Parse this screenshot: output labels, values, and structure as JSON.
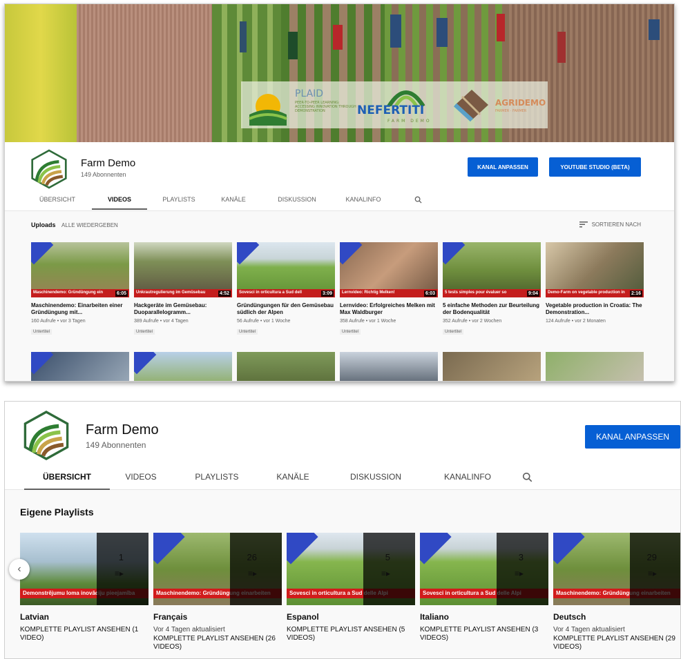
{
  "screen1": {
    "banner": {
      "logos": [
        "PLAID",
        "NEFERTITI",
        "AGRIDEMO"
      ],
      "plaid_tagline": "PEER-TO-PEER LEARNING: ACCESSING INNOVATION THROUGH DEMONSTRATION",
      "nefertiti_sub": "FARM DEMO",
      "agridemo_sub": "FARMER · FARMER"
    },
    "channel": {
      "name": "Farm Demo",
      "subscribers": "149 Abonnenten"
    },
    "buttons": {
      "customize": "KANAL ANPASSEN",
      "studio": "YOUTUBE STUDIO (BETA)"
    },
    "tabs": [
      "ÜBERSICHT",
      "VIDEOS",
      "PLAYLISTS",
      "KANÄLE",
      "DISKUSSION",
      "KANALINFO"
    ],
    "active_tab": "VIDEOS",
    "uploads_label": "Uploads",
    "play_all": "ALLE WIEDERGEBEN",
    "sort_label": "SORTIEREN NACH",
    "videos": [
      {
        "band": "Maschinendemo: Gründüngung ein",
        "duration": "6:05",
        "title": "Maschinendemo: Einarbeiten einer Gründüngung mit...",
        "meta": "160 Aufrufe • vor 3 Tagen",
        "badge": "Untertitel"
      },
      {
        "band": "Unkrautregulierung im Gemüsebau",
        "duration": "4:52",
        "title": "Hackgeräte im Gemüsebau: Duoparallelogramm...",
        "meta": "389 Aufrufe • vor 4 Tagen",
        "badge": "Untertitel"
      },
      {
        "band": "Sovesci in orticultura a Sud dell",
        "duration": "3:09",
        "title": "Gründüngungen für den Gemüsebau südlich der Alpen",
        "meta": "56 Aufrufe • vor 1 Woche",
        "badge": "Untertitel"
      },
      {
        "band": "Lernvideo: Richtig Melken!",
        "duration": "6:03",
        "title": "Lernvideo: Erfolgreiches Melken mit Max Waldburger",
        "meta": "358 Aufrufe • vor 1 Woche",
        "badge": "Untertitel"
      },
      {
        "band": "5 tests simples pour évaluer so",
        "duration": "9:04",
        "title": "5 einfache Methoden zur Beurteilung der Bodenqualität",
        "meta": "352 Aufrufe • vor 2 Wochen",
        "badge": "Untertitel"
      },
      {
        "band": "Demo-Farm on vegetable production in",
        "duration": "2:16",
        "title": "Vegetable production in Croatia: The Demonstration...",
        "meta": "124 Aufrufe • vor 2 Monaten",
        "badge": ""
      }
    ]
  },
  "screen2": {
    "channel": {
      "name": "Farm Demo",
      "subscribers": "149 Abonnenten"
    },
    "customize": "KANAL ANPASSEN",
    "tabs": [
      "ÜBERSICHT",
      "VIDEOS",
      "PLAYLISTS",
      "KANÄLE",
      "DISKUSSION",
      "KANALINFO"
    ],
    "active_tab": "ÜBERSICHT",
    "section_title": "Eigene Playlists",
    "playlists": [
      {
        "title": "Latvian",
        "count": "1",
        "band": "Demonstrējumu loma inovāciju pieejamība",
        "updated": "",
        "view": "KOMPLETTE PLAYLIST ANSEHEN (1 VIDEO)"
      },
      {
        "title": "Français",
        "count": "26",
        "band": "Maschinendemo: Gründüngung einarbeiten",
        "updated": "Vor 4 Tagen aktualisiert",
        "view": "KOMPLETTE PLAYLIST ANSEHEN (26 VIDEOS)"
      },
      {
        "title": "Espanol",
        "count": "5",
        "band": "Sovesci in orticultura a Sud delle Alpi",
        "updated": "",
        "view": "KOMPLETTE PLAYLIST ANSEHEN (5 VIDEOS)"
      },
      {
        "title": "Italiano",
        "count": "3",
        "band": "Sovesci in orticultura a Sud delle Alpi",
        "updated": "",
        "view": "KOMPLETTE PLAYLIST ANSEHEN (3 VIDEOS)"
      },
      {
        "title": "Deutsch",
        "count": "29",
        "band": "Maschinendemo: Gründüngung einarbeiten",
        "updated": "Vor 4 Tagen aktualisiert",
        "view": "KOMPLETTE PLAYLIST ANSEHEN (29 VIDEOS)"
      }
    ]
  },
  "colors": {
    "accent": "#065fd4",
    "band_red": "#c41d1d",
    "corner_blue": "#3049c4"
  }
}
